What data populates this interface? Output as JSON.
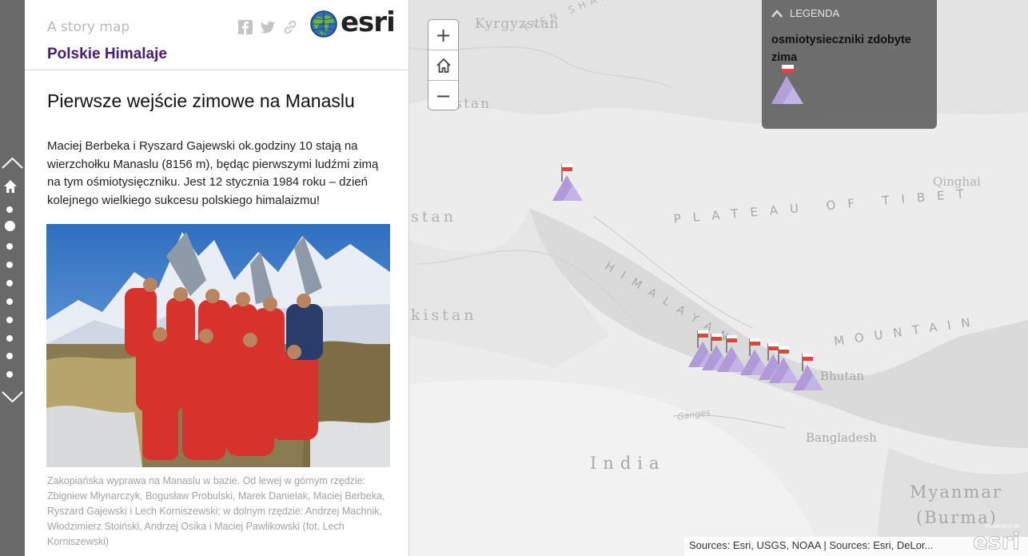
{
  "header": {
    "tagline": "A story map",
    "series_title": "Polskie Himalaje",
    "brand": "esri",
    "share_icons": [
      "facebook-icon",
      "twitter-icon",
      "link-icon"
    ]
  },
  "story": {
    "title": "Pierwsze wejście zimowe na Manaslu",
    "body": "Maciej Berbeka i Ryszard Gajewski ok.godziny 10 stają na wierzchołku Manaslu (8156 m), będąc pierwszymi ludźmi zimą na tym ośmiotysięczniku. Jest 12 stycznia 1984 roku – dzień kolejnego wielkiego sukcesu polskiego himalaizmu!",
    "caption": "Zakopiańska wyprawa na Manaslu w bazie. Od lewej w górnym rzędzie: Zbigniew Młynarczyk, Bogusław Probulski, Marek Danielak, Maciej Berbeka, Ryszard Gajewski i Lech Korniszewski; w dolnym rzędzie: Andrzej Machnik, Włodzimierz Stoiński, Andrzej Osika i Maciej Pawlikowski (fot. Lech Korniszewski)"
  },
  "nav": {
    "section_count": 11,
    "active_index": 1
  },
  "map": {
    "zoom_in": "+",
    "home": "home-icon",
    "zoom_out": "−",
    "labels": {
      "kyrgyzstan": "Kyrgyzstan",
      "tien_shan": "TIEN SHAN",
      "istan": "istan",
      "stan": "stan",
      "qinghai": "Qinghai",
      "plateau": "PLATEAU OF TIBET",
      "himalaya": "HIMALAYAN",
      "mountain": "MOUNTAIN",
      "kistan": "kistan",
      "bhutan": "Bhutan",
      "bangladesh": "Bangladesh",
      "ganges": "Ganges",
      "india": "India",
      "myanmar": "Myanmar",
      "burma": "(Burma)"
    },
    "legend": {
      "title": "LEGENDA",
      "label": "osmiotysieczniki zdobyte zima"
    },
    "attribution": "Sources: Esri, USGS, NOAA | Sources: Esri, DeLor...",
    "powered_by": "POWERED BY",
    "powered_brand": "esri",
    "colors": {
      "marker_fill": "#c3b3e6",
      "flag": "#e8403c",
      "accent": "#4b1a7a",
      "legend_bg": "#696969"
    }
  }
}
